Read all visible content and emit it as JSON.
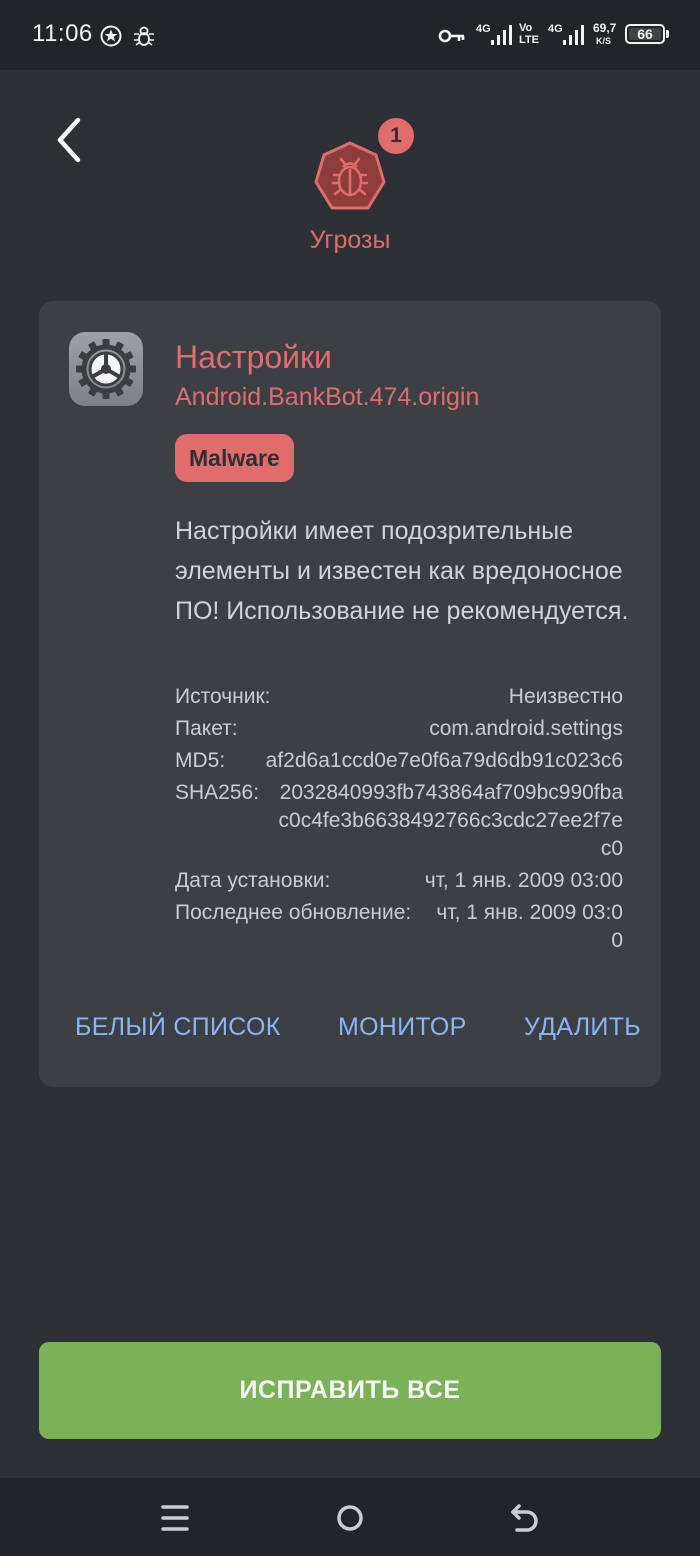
{
  "status_bar": {
    "time": "11:06",
    "net1": "4G",
    "volte_top": "Vo",
    "volte_bottom": "LTE",
    "net2": "4G",
    "speed_value": "69,7",
    "speed_unit": "K/S",
    "battery": "66",
    "icons": [
      "star-circle-icon",
      "bug-notification-icon",
      "vpn-key-icon",
      "signal-icon",
      "signal-icon",
      "battery-icon"
    ]
  },
  "header": {
    "threat_count": "1",
    "title": "Угрозы",
    "icons": [
      "back-arrow-icon",
      "bug-octagon-icon"
    ]
  },
  "threat": {
    "app_name": "Настройки",
    "threat_name": "Android.BankBot.474.origin",
    "badge": "Malware",
    "description": "Настройки имеет подозрительные элементы и известен как вредоносное ПО! Использование не рекомендуется.",
    "details": [
      {
        "label": "Источник:",
        "value": "Неизвестно"
      },
      {
        "label": "Пакет:",
        "value": "com.android.settings"
      },
      {
        "label": "MD5:",
        "value": "af2d6a1ccd0e7e0f6a79d6db91c023c6"
      },
      {
        "label": "SHA256:",
        "value": "2032840993fb743864af709bc990fbac0c4fe3b6638492766c3cdc27ee2f7ec0"
      },
      {
        "label": "Дата установки:",
        "value": "чт, 1 янв. 2009 03:00"
      },
      {
        "label": "Последнее обновление:",
        "value": "чт, 1 янв. 2009 03:00"
      }
    ],
    "actions": {
      "whitelist": "БЕЛЫЙ СПИСОК",
      "monitor": "МОНИТОР",
      "delete": "УДАЛИТЬ"
    }
  },
  "fix_all": "ИСПРАВИТЬ ВСЕ",
  "nav": {
    "icons": [
      "menu-icon",
      "home-icon",
      "back-icon"
    ]
  },
  "colors": {
    "background": "#2d3135",
    "card": "#3c4045",
    "danger": "#e06c6c",
    "accent": "#8ab4f8",
    "success": "#7cb257"
  }
}
